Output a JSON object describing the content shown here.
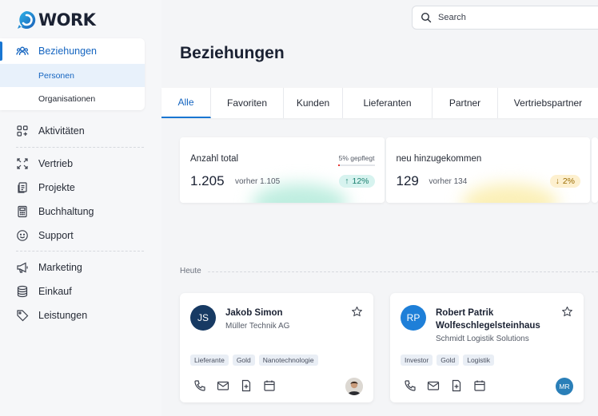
{
  "app": {
    "logo_text": "WORK"
  },
  "sidebar": {
    "groups": [
      {
        "label": "Beziehungen",
        "icon": "people-icon"
      }
    ],
    "sub": [
      "Personen",
      "Organisationen"
    ],
    "items": [
      {
        "label": "Aktivitäten",
        "icon": "grid-add-icon"
      },
      {
        "label": "Vertrieb",
        "icon": "expand-icon"
      },
      {
        "label": "Projekte",
        "icon": "documents-icon"
      },
      {
        "label": "Buchhaltung",
        "icon": "calculator-icon"
      },
      {
        "label": "Support",
        "icon": "smiley-icon"
      },
      {
        "label": "Marketing",
        "icon": "megaphone-icon"
      },
      {
        "label": "Einkauf",
        "icon": "database-icon"
      },
      {
        "label": "Leistungen",
        "icon": "tag-icon"
      }
    ]
  },
  "search": {
    "placeholder": "Search"
  },
  "page": {
    "title": "Beziehungen"
  },
  "tabs": [
    "Alle",
    "Favoriten",
    "Kunden",
    "Lieferanten",
    "Partner",
    "Vertriebspartner"
  ],
  "stats": [
    {
      "label": "Anzahl total",
      "value": "1.205",
      "prev": "vorher 1.105",
      "badge": "12%",
      "direction": "up",
      "care_label": "5% gepflegt",
      "care_fraction": 0.05,
      "badge_bg": "#d7f3ef",
      "badge_color": "#1a7f6f",
      "glow": "#bfeee0"
    },
    {
      "label": "neu hinzugekommen",
      "value": "129",
      "prev": "vorher 134",
      "badge": "2%",
      "direction": "down",
      "badge_bg": "#fdf0cf",
      "badge_color": "#9a6b00",
      "glow": "#fbf0b8"
    }
  ],
  "section": {
    "label": "Heute"
  },
  "cards": [
    {
      "initials": "JS",
      "name": "Jakob Simon",
      "company": "Müller Technik AG",
      "tags": [
        "Lieferante",
        "Gold",
        "Nanotechnologie"
      ],
      "avatar_color": "#173a63",
      "owner": "photo"
    },
    {
      "initials": "RP",
      "name": "Robert Patrik Wolfeschlegelsteinhaus",
      "company": "Schmidt Logistik Solutions",
      "tags": [
        "Investor",
        "Gold",
        "Logistik"
      ],
      "avatar_color": "#1e7fd8",
      "owner": "MR",
      "owner_color": "#2a7fb8"
    }
  ],
  "colors": {
    "accent": "#1976d2"
  }
}
